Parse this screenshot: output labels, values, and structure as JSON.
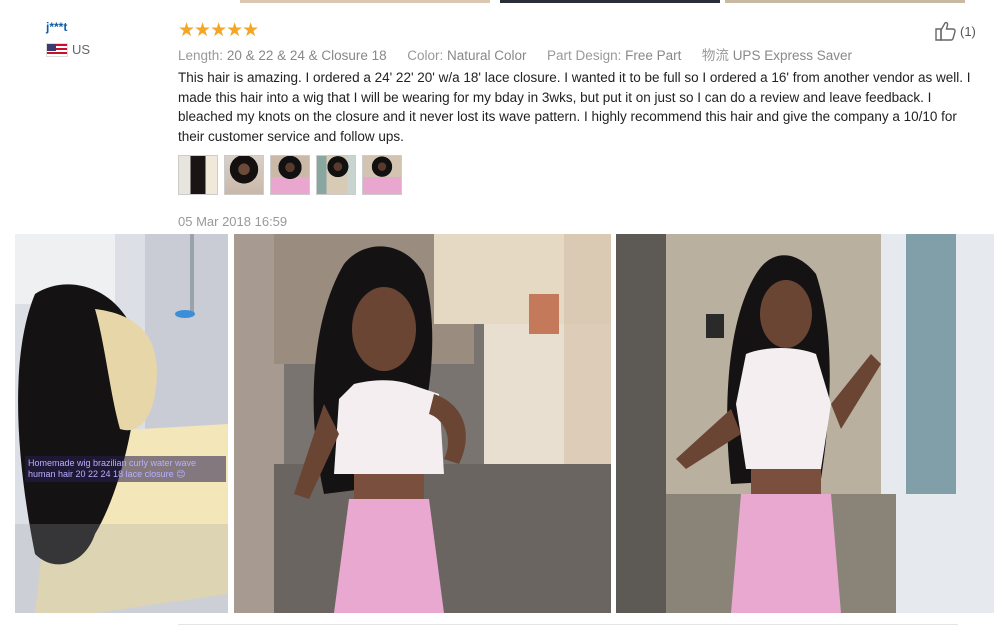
{
  "review": {
    "reviewer": {
      "name": "j***t",
      "country": "US"
    },
    "rating": {
      "stars": 5,
      "max": 5,
      "glyphs": "★★★★★"
    },
    "helpful": {
      "count_label": "(1)",
      "icon": "thumbs-up-icon"
    },
    "attributes": [
      {
        "key": "Length:",
        "value": "20 & 22 & 24 & Closure 18"
      },
      {
        "key": "Color:",
        "value": "Natural Color"
      },
      {
        "key": "Part Design:",
        "value": "Free Part"
      },
      {
        "key": "物流",
        "value": "UPS Express Saver"
      }
    ],
    "text": "This hair is amazing. I ordered a 24' 22' 20' w/a 18' lace closure. I wanted it to be full so I ordered a 16' from another vendor as well. I made this hair into a wig that I will be wearing for my bday in 3wks, but put it on just so I can do a review and leave feedback. I bleached my knots on the closure and it never lost its wave pattern. I highly recommend this hair and give the company a 10/10 for their customer service and follow ups.",
    "thumbnails": [
      {
        "name": "review-photo-thumb-1"
      },
      {
        "name": "review-photo-thumb-2"
      },
      {
        "name": "review-photo-thumb-3"
      },
      {
        "name": "review-photo-thumb-4"
      },
      {
        "name": "review-photo-thumb-5"
      }
    ],
    "date": "05 Mar 2018 16:59",
    "photos": [
      {
        "name": "review-photo-wig-on-mannequin",
        "caption": "Homemade wig brazilian curly water wave human hair 20 22 24 18 lace closure 😊"
      },
      {
        "name": "review-photo-front-selfie"
      },
      {
        "name": "review-photo-full-body"
      }
    ]
  },
  "colors": {
    "star": "#f5a623",
    "username": "#0b5cad",
    "meta_text": "#888888",
    "body_text": "#222222",
    "date": "#999999"
  }
}
